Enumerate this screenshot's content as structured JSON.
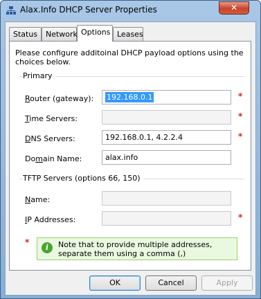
{
  "window": {
    "title": "Alax.Info DHCP Server Properties",
    "close_label": "✕"
  },
  "tabs": [
    {
      "label": "Status",
      "active": false
    },
    {
      "label": "Network",
      "active": false
    },
    {
      "label": "Options",
      "active": true
    },
    {
      "label": "Leases",
      "active": false
    }
  ],
  "intro_text": "Please configure additoinal DHCP payload options using the choices below.",
  "primary": {
    "title": "Primary",
    "router": {
      "label_prefix": "",
      "label_u": "R",
      "label_rest": "outer (gateway):",
      "value": "192.168.0.1",
      "required": "*"
    },
    "time_servers": {
      "label_u": "T",
      "label_rest": "ime Servers:",
      "value": "",
      "required": "*"
    },
    "dns_servers": {
      "label_u": "D",
      "label_rest": "NS Servers:",
      "value": "192.168.0.1, 4.2.2.4",
      "required": "*"
    },
    "domain_name": {
      "label_pre": "Do",
      "label_u": "m",
      "label_rest": "ain Name:",
      "value": "alax.info"
    }
  },
  "tftp": {
    "title": "TFTP Servers (options 66, 150)",
    "name": {
      "label_u": "N",
      "label_rest": "ame:",
      "value": ""
    },
    "ip_addresses": {
      "label_u": "I",
      "label_rest": "P Addresses:",
      "value": "",
      "required": "*"
    }
  },
  "note": {
    "marker": "*",
    "icon": "i",
    "text": "Note that to provide multiple addresses, separate them using a comma (,)"
  },
  "buttons": {
    "ok": "OK",
    "cancel": "Cancel",
    "apply": "Apply"
  },
  "colors": {
    "accent": "#3399ff",
    "required": "#d61f1f",
    "note_bg": "#e9f9e0"
  }
}
